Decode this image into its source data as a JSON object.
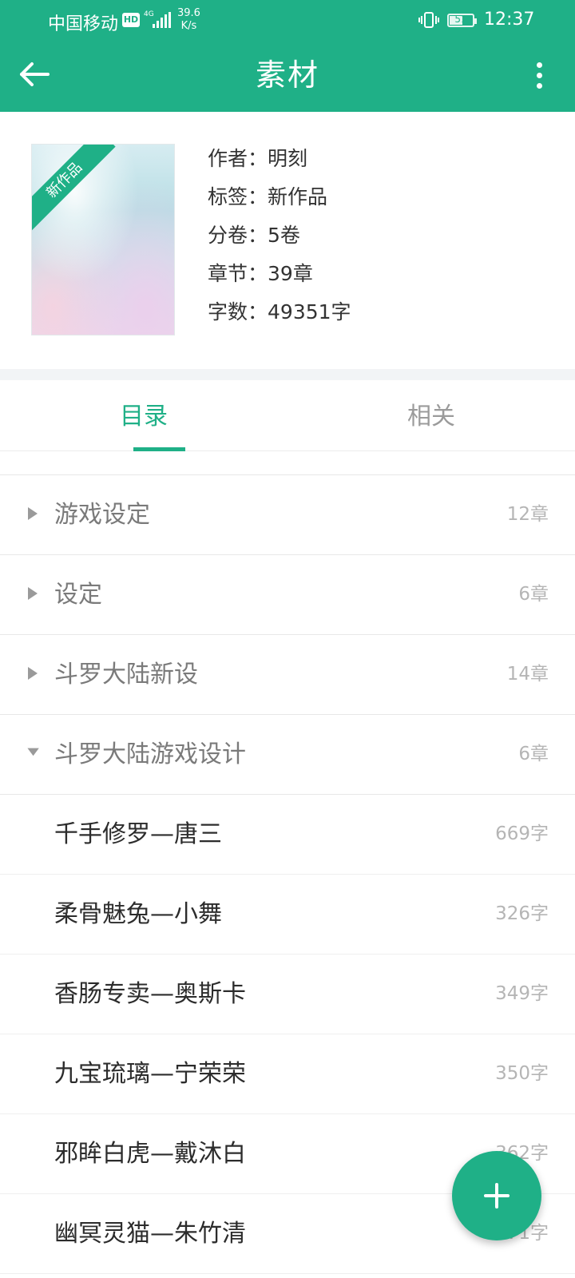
{
  "status_bar": {
    "carrier": "中国移动",
    "hd_badge": "HD",
    "net_type": "4G",
    "speed_value": "39.6",
    "speed_unit": "K/s",
    "battery_level": "51",
    "time": "12:37"
  },
  "header": {
    "title": "素材",
    "back_icon": "arrow-left-icon",
    "more_icon": "more-vertical-icon"
  },
  "book": {
    "ribbon": "新作品",
    "meta": [
      {
        "label": "作者：",
        "value": "明刻"
      },
      {
        "label": "标签：",
        "value": "新作品"
      },
      {
        "label": "分卷：",
        "value": "5卷"
      },
      {
        "label": "章节：",
        "value": "39章"
      },
      {
        "label": "字数：",
        "value": "49351字"
      }
    ]
  },
  "tabs": [
    {
      "label": "目录",
      "active": true
    },
    {
      "label": "相关",
      "active": false
    }
  ],
  "volumes": [
    {
      "title": "游戏设定",
      "count": "12章",
      "expanded": false
    },
    {
      "title": "设定",
      "count": "6章",
      "expanded": false
    },
    {
      "title": "斗罗大陆新设",
      "count": "14章",
      "expanded": false
    },
    {
      "title": "斗罗大陆游戏设计",
      "count": "6章",
      "expanded": true
    }
  ],
  "chapters": [
    {
      "title": "千手修罗—唐三",
      "count": "669字"
    },
    {
      "title": "柔骨魅兔—小舞",
      "count": "326字"
    },
    {
      "title": "香肠专卖—奥斯卡",
      "count": "349字"
    },
    {
      "title": "九宝琉璃—宁荣荣",
      "count": "350字"
    },
    {
      "title": "邪眸白虎—戴沐白",
      "count": "362字"
    },
    {
      "title": "幽冥灵猫—朱竹清",
      "count": "371字"
    }
  ],
  "fab": {
    "icon": "plus-icon"
  },
  "colors": {
    "accent": "#1fb087",
    "gap": "#f2f4f6"
  }
}
